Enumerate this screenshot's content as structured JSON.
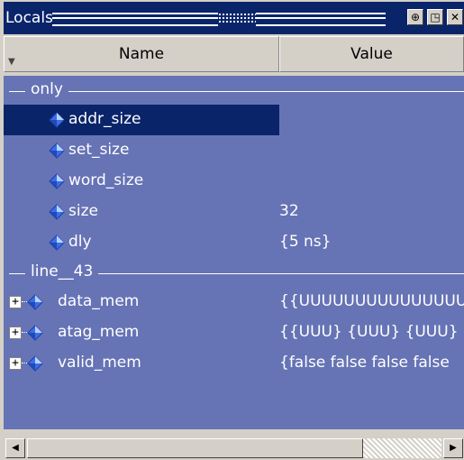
{
  "window": {
    "title": "Locals"
  },
  "columns": {
    "name": "Name",
    "value": "Value"
  },
  "groups": [
    {
      "label": "only",
      "items": [
        {
          "name": "addr_size",
          "value": "",
          "selected": true,
          "expandable": false
        },
        {
          "name": "set_size",
          "value": "",
          "selected": false,
          "expandable": false
        },
        {
          "name": "word_size",
          "value": "",
          "selected": false,
          "expandable": false
        },
        {
          "name": "size",
          "value": "32",
          "selected": false,
          "expandable": false
        },
        {
          "name": "dly",
          "value": "{5 ns}",
          "selected": false,
          "expandable": false
        }
      ]
    },
    {
      "label": "line__43",
      "items": [
        {
          "name": "data_mem",
          "value": "{{UUUUUUUUUUUUUUUU",
          "selected": false,
          "expandable": true
        },
        {
          "name": "atag_mem",
          "value": "{{UUU} {UUU} {UUU}",
          "selected": false,
          "expandable": true
        },
        {
          "name": "valid_mem",
          "value": "{false false false false",
          "selected": false,
          "expandable": true
        }
      ]
    }
  ],
  "icons": {
    "title_buttons": [
      "dock-icon",
      "undock-icon",
      "close-icon"
    ],
    "item": "diamond-variable-icon",
    "expander": "plus-icon",
    "sort": "sort-arrow-icon"
  },
  "colors": {
    "pane_bg": "#6673b5",
    "selection": "#0a246a",
    "title_bg": "#0a246a",
    "chrome": "#d4d0c8"
  },
  "scroll": {
    "horizontal_thumb_fraction": 0.81
  }
}
